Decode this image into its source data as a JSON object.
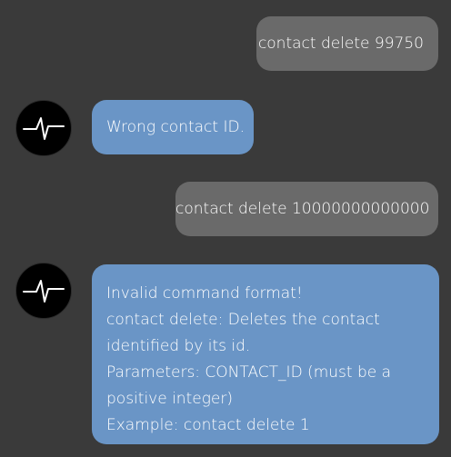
{
  "messages": [
    {
      "role": "user",
      "text": "contact delete 99750"
    },
    {
      "role": "bot",
      "text": "Wrong contact ID."
    },
    {
      "role": "user",
      "text": "contact delete 10000000000000"
    },
    {
      "role": "bot",
      "lines": [
        "Invalid command format!",
        "contact delete: Deletes the contact",
        "identified by its id.",
        "Parameters: CONTACT_ID (must be a",
        "positive integer)",
        "Example: contact delete 1"
      ]
    }
  ],
  "icons": {
    "bot_avatar": "heartbeat-pulse-icon"
  },
  "colors": {
    "background": "#3a3a3a",
    "user_bubble": "#6a6a6a",
    "bot_bubble": "#6a95c6",
    "avatar": "#000000",
    "text": "#ffffff"
  }
}
